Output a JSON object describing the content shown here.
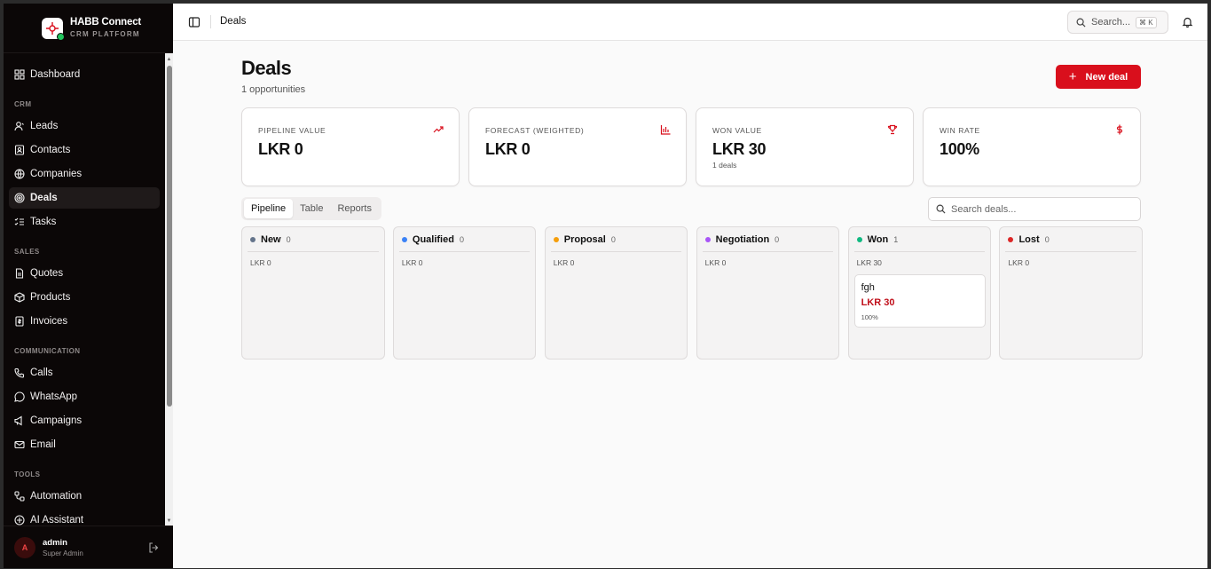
{
  "brand": {
    "title": "HABB Connect",
    "subtitle": "CRM PLATFORM"
  },
  "nav": {
    "dashboard": "Dashboard",
    "sections": {
      "crm": "CRM",
      "sales": "SALES",
      "communication": "COMMUNICATION",
      "tools": "TOOLS"
    },
    "crm_items": [
      "Leads",
      "Contacts",
      "Companies",
      "Deals",
      "Tasks"
    ],
    "sales_items": [
      "Quotes",
      "Products",
      "Invoices"
    ],
    "communication_items": [
      "Calls",
      "WhatsApp",
      "Campaigns",
      "Email"
    ],
    "tools_items": [
      "Automation",
      "AI Assistant"
    ]
  },
  "user": {
    "initial": "A",
    "name": "admin",
    "role": "Super Admin"
  },
  "topbar": {
    "breadcrumb": "Deals",
    "search_label": "Search...",
    "shortcut": "⌘ K"
  },
  "page": {
    "title": "Deals",
    "subtitle": "1 opportunities",
    "new_button": "New deal"
  },
  "stats": [
    {
      "label": "PIPELINE VALUE",
      "value": "LKR 0",
      "note": "",
      "icon": "trending-up-icon"
    },
    {
      "label": "FORECAST (WEIGHTED)",
      "value": "LKR 0",
      "note": "",
      "icon": "bar-chart-icon"
    },
    {
      "label": "WON VALUE",
      "value": "LKR 30",
      "note": "1 deals",
      "icon": "trophy-icon"
    },
    {
      "label": "WIN RATE",
      "value": "100%",
      "note": "",
      "icon": "dollar-icon"
    }
  ],
  "tabs": [
    "Pipeline",
    "Table",
    "Reports"
  ],
  "deal_search": {
    "placeholder": "Search deals..."
  },
  "columns": [
    {
      "name": "New",
      "count": "0",
      "total": "LKR 0",
      "color": "#64748b"
    },
    {
      "name": "Qualified",
      "count": "0",
      "total": "LKR 0",
      "color": "#3b82f6"
    },
    {
      "name": "Proposal",
      "count": "0",
      "total": "LKR 0",
      "color": "#f59e0b"
    },
    {
      "name": "Negotiation",
      "count": "0",
      "total": "LKR 0",
      "color": "#a855f7"
    },
    {
      "name": "Won",
      "count": "1",
      "total": "LKR 30",
      "color": "#10b981"
    },
    {
      "name": "Lost",
      "count": "0",
      "total": "LKR 0",
      "color": "#dc2626"
    }
  ],
  "won_card": {
    "name": "fgh",
    "value": "LKR 30",
    "probability": "100%"
  },
  "colors": {
    "accent": "#d90f1c",
    "sidebar": "#0b0707"
  }
}
